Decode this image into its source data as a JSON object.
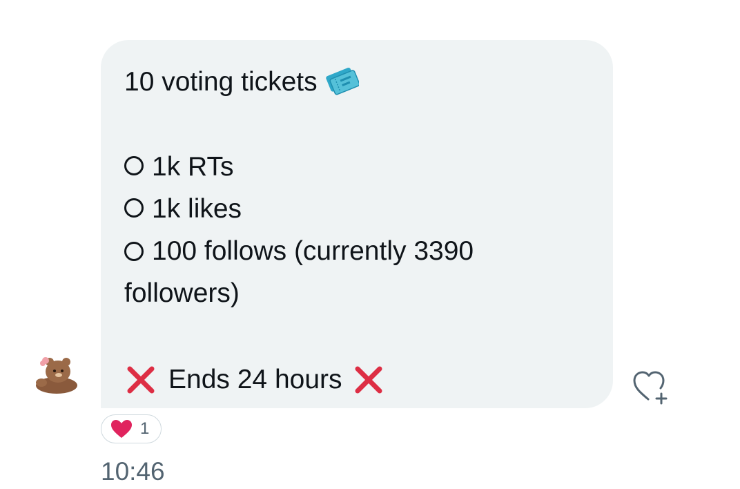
{
  "message": {
    "title": "10 voting tickets",
    "title_emoji": "ticket-icon",
    "options": [
      {
        "label": "1k RTs"
      },
      {
        "label": "1k likes"
      },
      {
        "label": "100 follows (currently 3390 followers)"
      }
    ],
    "footer": "Ends 24 hours",
    "footer_emoji": "cross-mark-icon"
  },
  "reaction": {
    "emoji": "heart-icon",
    "count": "1"
  },
  "timestamp": "10:46",
  "colors": {
    "bubble": "#eff3f4",
    "text": "#0f1419",
    "muted": "#536471",
    "heart": "#e0245e",
    "cross": "#dd2e44",
    "ticket": "#55c1d9"
  }
}
